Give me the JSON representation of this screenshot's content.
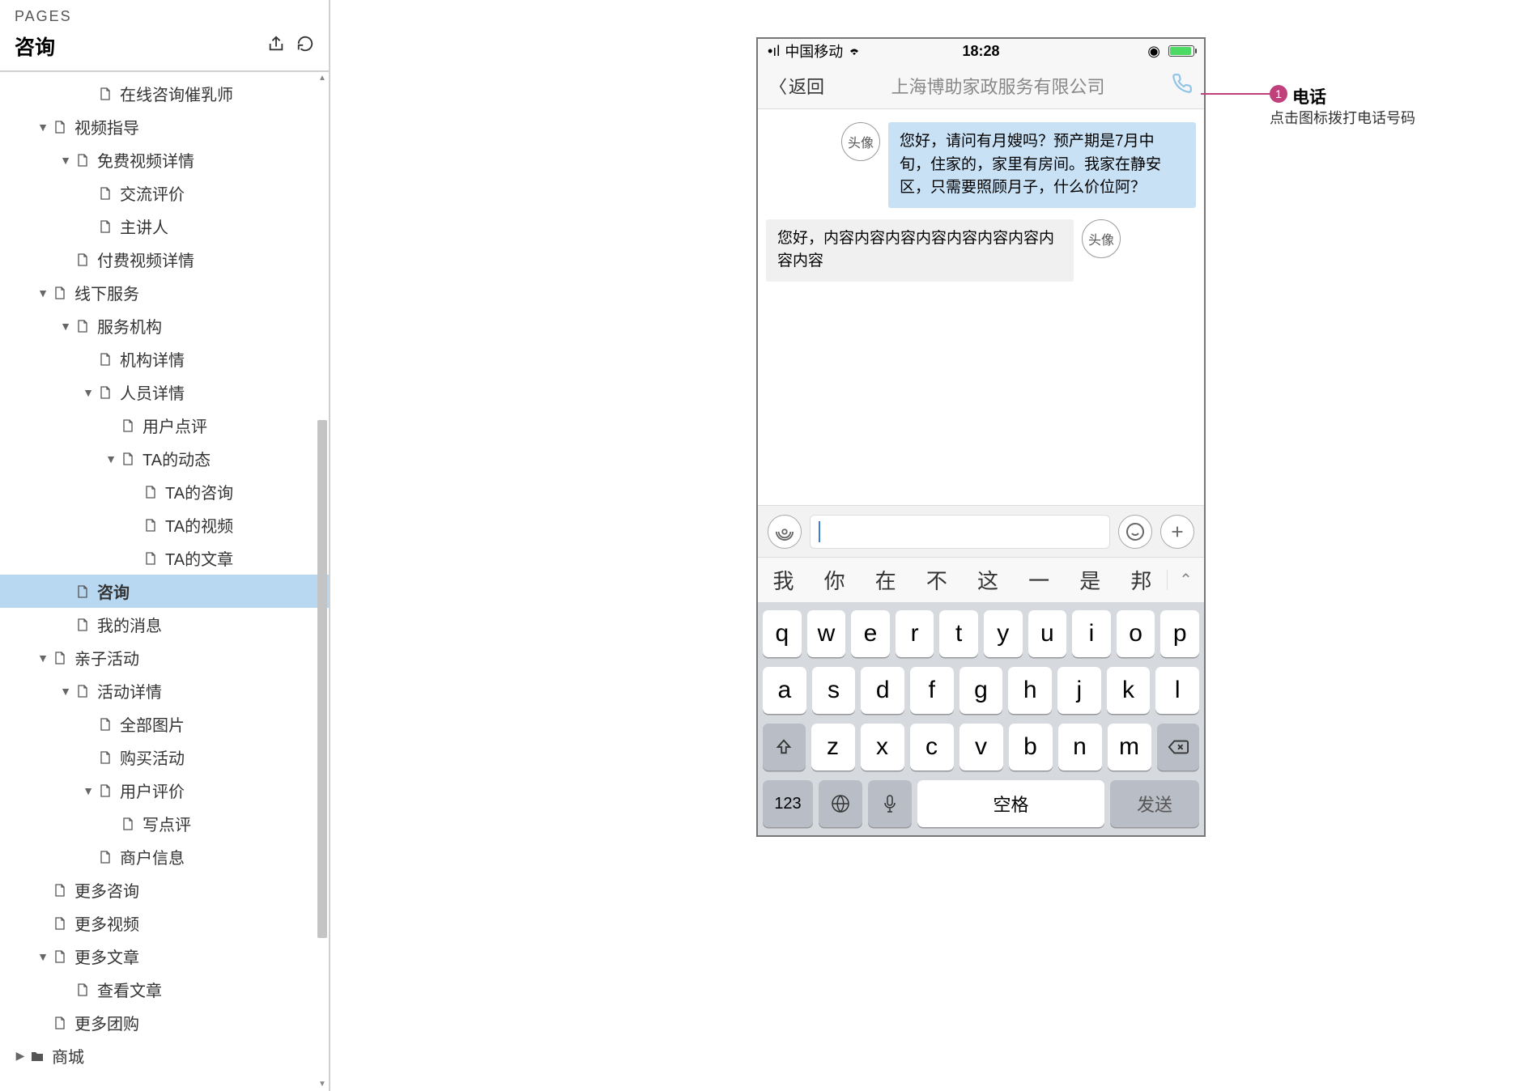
{
  "sidebar": {
    "pages_label": "PAGES",
    "title": "咨询",
    "tree": [
      {
        "level": 3,
        "caret": "",
        "type": "doc",
        "label": "在线咨询催乳师"
      },
      {
        "level": 1,
        "caret": "▼",
        "type": "doc",
        "label": "视频指导"
      },
      {
        "level": 2,
        "caret": "▼",
        "type": "doc",
        "label": "免费视频详情"
      },
      {
        "level": 3,
        "caret": "",
        "type": "doc",
        "label": "交流评价"
      },
      {
        "level": 3,
        "caret": "",
        "type": "doc",
        "label": "主讲人"
      },
      {
        "level": 2,
        "caret": "",
        "type": "doc",
        "label": "付费视频详情"
      },
      {
        "level": 1,
        "caret": "▼",
        "type": "doc",
        "label": "线下服务"
      },
      {
        "level": 2,
        "caret": "▼",
        "type": "doc",
        "label": "服务机构"
      },
      {
        "level": 3,
        "caret": "",
        "type": "doc",
        "label": "机构详情"
      },
      {
        "level": 3,
        "caret": "▼",
        "type": "doc",
        "label": "人员详情"
      },
      {
        "level": 4,
        "caret": "",
        "type": "doc",
        "label": "用户点评"
      },
      {
        "level": 4,
        "caret": "▼",
        "type": "doc",
        "label": "TA的动态"
      },
      {
        "level": 5,
        "caret": "",
        "type": "doc",
        "label": "TA的咨询"
      },
      {
        "level": 5,
        "caret": "",
        "type": "doc",
        "label": "TA的视频"
      },
      {
        "level": 5,
        "caret": "",
        "type": "doc",
        "label": "TA的文章"
      },
      {
        "level": 2,
        "caret": "",
        "type": "doc",
        "label": "咨询",
        "selected": true
      },
      {
        "level": 2,
        "caret": "",
        "type": "doc",
        "label": "我的消息"
      },
      {
        "level": 1,
        "caret": "▼",
        "type": "doc",
        "label": "亲子活动"
      },
      {
        "level": 2,
        "caret": "▼",
        "type": "doc",
        "label": "活动详情"
      },
      {
        "level": 3,
        "caret": "",
        "type": "doc",
        "label": "全部图片"
      },
      {
        "level": 3,
        "caret": "",
        "type": "doc",
        "label": "购买活动"
      },
      {
        "level": 3,
        "caret": "▼",
        "type": "doc",
        "label": "用户评价"
      },
      {
        "level": 4,
        "caret": "",
        "type": "doc",
        "label": "写点评"
      },
      {
        "level": 3,
        "caret": "",
        "type": "doc",
        "label": "商户信息"
      },
      {
        "level": 1,
        "caret": "",
        "type": "doc",
        "label": "更多咨询"
      },
      {
        "level": 1,
        "caret": "",
        "type": "doc",
        "label": "更多视频"
      },
      {
        "level": 1,
        "caret": "▼",
        "type": "doc",
        "label": "更多文章"
      },
      {
        "level": 2,
        "caret": "",
        "type": "doc",
        "label": "查看文章"
      },
      {
        "level": 1,
        "caret": "",
        "type": "doc",
        "label": "更多团购"
      },
      {
        "level": 0,
        "caret": "▶",
        "type": "folder",
        "label": "商城"
      }
    ]
  },
  "phone": {
    "status": {
      "carrier": "中国移动",
      "time": "18:28"
    },
    "nav": {
      "back": "返回",
      "title": "上海博助家政服务有限公司"
    },
    "messages": [
      {
        "side": "me",
        "avatar": "头像",
        "text": "您好，请问有月嫂吗？预产期是7月中旬，住家的，家里有房间。我家在静安区，只需要照顾月子，什么价位阿？"
      },
      {
        "side": "other",
        "avatar": "头像",
        "text": "您好，内容内容内容内容内容内容内容内容内容"
      }
    ],
    "predictive": [
      "我",
      "你",
      "在",
      "不",
      "这",
      "一",
      "是",
      "邦"
    ],
    "keyboard": {
      "row1": [
        "q",
        "w",
        "e",
        "r",
        "t",
        "y",
        "u",
        "i",
        "o",
        "p"
      ],
      "row2": [
        "a",
        "s",
        "d",
        "f",
        "g",
        "h",
        "j",
        "k",
        "l"
      ],
      "row3": [
        "z",
        "x",
        "c",
        "v",
        "b",
        "n",
        "m"
      ],
      "num": "123",
      "space": "空格",
      "send": "发送"
    }
  },
  "annotation": {
    "number": "1",
    "title": "电话",
    "desc": "点击图标拨打电话号码"
  }
}
